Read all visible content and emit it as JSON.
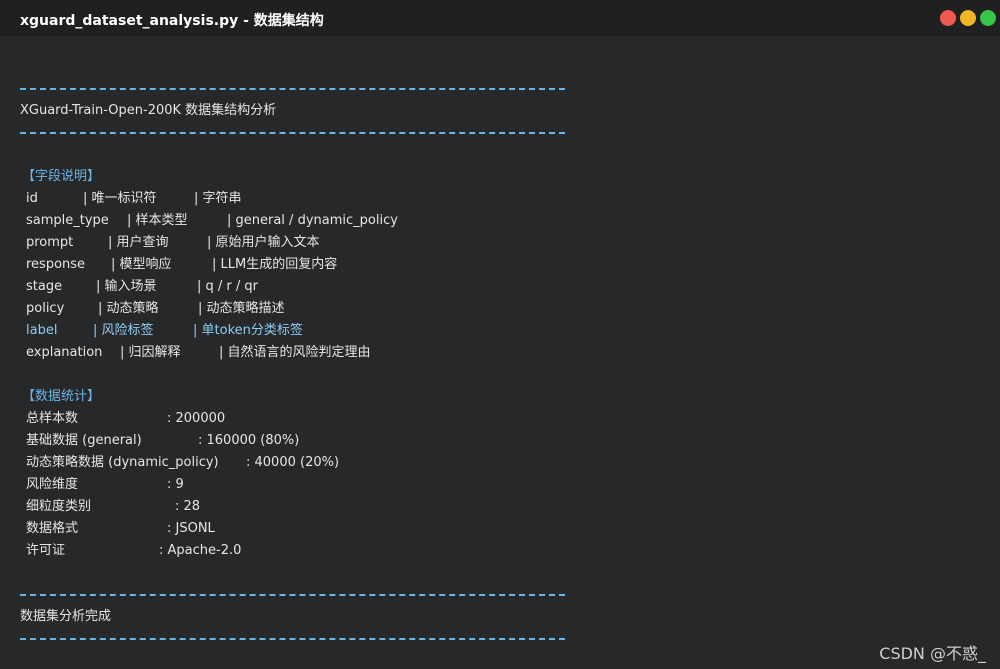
{
  "window": {
    "title": "xguard_dataset_analysis.py - 数据集结构",
    "controls": [
      "close-button",
      "minimize-button",
      "maximize-button"
    ]
  },
  "output": {
    "heading": "XGuard-Train-Open-200K 数据集结构分析",
    "fields_section": {
      "title": "【字段说明】",
      "rows": [
        {
          "name": "id",
          "desc": "| 唯一标识符",
          "type": "| 字符串"
        },
        {
          "name": "sample_type",
          "desc": "| 样本类型",
          "type": "| general / dynamic_policy"
        },
        {
          "name": "prompt",
          "desc": "| 用户查询",
          "type": "| 原始用户输入文本"
        },
        {
          "name": "response",
          "desc": "| 模型响应",
          "type": "| LLM生成的回复内容"
        },
        {
          "name": "stage",
          "desc": "| 输入场景",
          "type": "| q / r / qr"
        },
        {
          "name": "policy",
          "desc": "| 动态策略",
          "type": "| 动态策略描述"
        },
        {
          "name": "label",
          "desc": "| 风险标签",
          "type": "| 单token分类标签"
        },
        {
          "name": "explanation",
          "desc": "| 归因解释",
          "type": "| 自然语言的风险判定理由"
        }
      ]
    },
    "stats_section": {
      "title": "【数据统计】",
      "rows": [
        {
          "key": "总样本数",
          "value": ": 200000"
        },
        {
          "key": "基础数据 (general)",
          "value": ": 160000 (80%)"
        },
        {
          "key": "动态策略数据 (dynamic_policy)",
          "value": ": 40000 (20%)"
        },
        {
          "key": "风险维度",
          "value": ": 9"
        },
        {
          "key": "细粒度类别",
          "value": ": 28"
        },
        {
          "key": "数据格式",
          "value": ": JSONL"
        },
        {
          "key": "许可证",
          "value": ": Apache-2.0"
        }
      ]
    },
    "footer": "数据集分析完成"
  },
  "watermark": "CSDN @不惑_",
  "colors": {
    "background": "#262829",
    "titlebar": "#1e2021",
    "accent": "#6ab6e6",
    "text": "#e6e6e6"
  }
}
